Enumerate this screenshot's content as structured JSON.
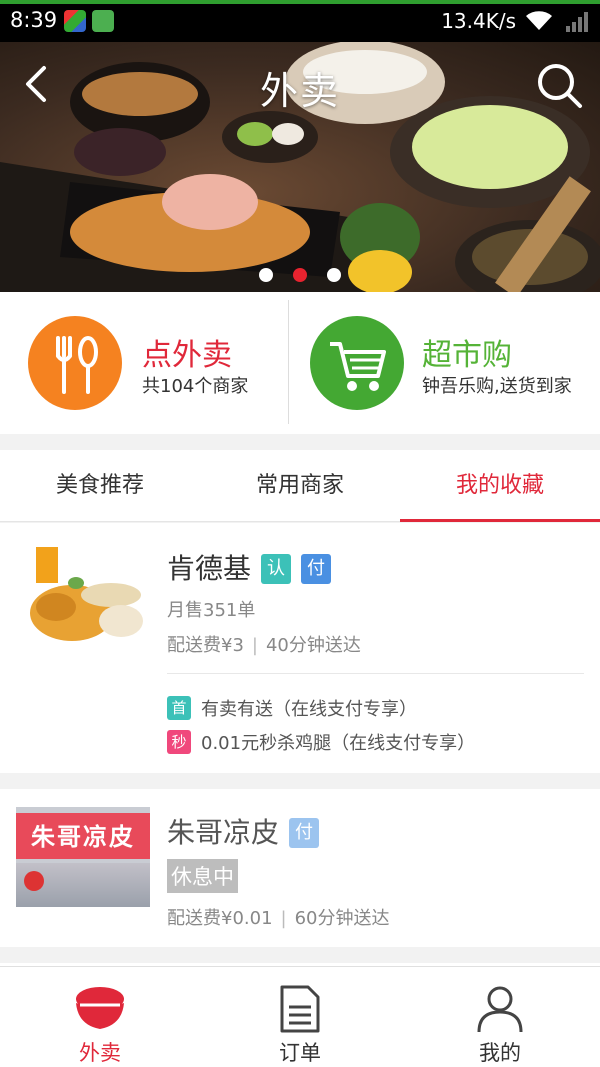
{
  "status_bar": {
    "time": "8:39",
    "speed": "13.4K/s"
  },
  "header": {
    "title": "外卖"
  },
  "banner": {
    "active_slide": 2,
    "slide_count": 3
  },
  "services": [
    {
      "title": "点外卖",
      "subtitle": "共104个商家",
      "icon": "fork-spoon-icon",
      "color": "#f58220",
      "title_color": "#e0283a"
    },
    {
      "title": "超市购",
      "subtitle": "钟吾乐购,送货到家",
      "icon": "shopping-cart-icon",
      "color": "#44a833",
      "title_color": "#55b337"
    }
  ],
  "tabs": [
    {
      "label": "美食推荐",
      "active": false
    },
    {
      "label": "常用商家",
      "active": false
    },
    {
      "label": "我的收藏",
      "active": true
    }
  ],
  "shops": [
    {
      "name": "肯德基",
      "badges": [
        {
          "text": "认",
          "color": "#3cc1b8"
        },
        {
          "text": "付",
          "color": "#4a90e2"
        }
      ],
      "monthly_sales": "月售351单",
      "delivery_fee": "配送费¥3",
      "delivery_time": "40分钟送达",
      "promos": [
        {
          "tag": "首",
          "tag_color": "#3cc1b8",
          "text": "有卖有送（在线支付专享）"
        },
        {
          "tag": "秒",
          "tag_color": "#f0487c",
          "text": "0.01元秒杀鸡腿（在线支付专享）"
        }
      ]
    },
    {
      "name": "朱哥凉皮",
      "badges": [
        {
          "text": "付",
          "color": "#9cc4ef"
        }
      ],
      "status": "休息中",
      "delivery_fee": "配送费¥0.01",
      "delivery_time": "60分钟送达",
      "sign_text": "朱哥凉皮"
    }
  ],
  "bottom_nav": [
    {
      "label": "外卖",
      "icon": "takeout-bowl-icon",
      "active": true
    },
    {
      "label": "订单",
      "icon": "order-document-icon",
      "active": false
    },
    {
      "label": "我的",
      "icon": "profile-icon",
      "active": false
    }
  ]
}
